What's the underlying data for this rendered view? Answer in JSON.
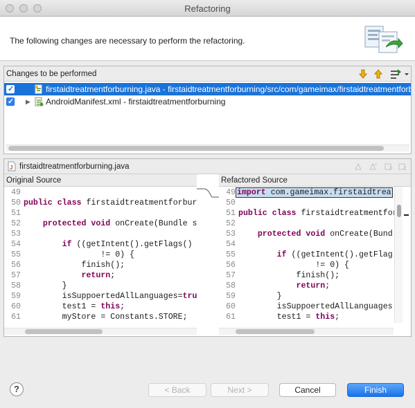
{
  "window": {
    "title": "Refactoring"
  },
  "header": {
    "message": "The following changes are necessary to perform the refactoring."
  },
  "changes": {
    "title": "Changes to be performed",
    "items": [
      {
        "label": "firstaidtreatmentforburning.java - firstaidtreatmentforburning/src/com/gameimax/firstaidtreatmentforburning",
        "checked": true,
        "selected": true
      },
      {
        "label": "AndroidManifest.xml - firstaidtreatmentforburning",
        "checked": true,
        "selected": false
      }
    ]
  },
  "compare": {
    "file": "firstaidtreatmentforburning.java",
    "original_label": "Original Source",
    "refactored_label": "Refactored Source",
    "original_lines": [
      {
        "n": "49",
        "t": ""
      },
      {
        "n": "50",
        "t": "public class firstaidtreatmentforburni"
      },
      {
        "n": "51",
        "t": ""
      },
      {
        "n": "52",
        "t": "    protected void onCreate(Bundle s"
      },
      {
        "n": "53",
        "t": ""
      },
      {
        "n": "54",
        "t": "        if ((getIntent().getFlags()"
      },
      {
        "n": "55",
        "t": "                != 0) {"
      },
      {
        "n": "56",
        "t": "            finish();"
      },
      {
        "n": "57",
        "t": "            return;"
      },
      {
        "n": "58",
        "t": "        }"
      },
      {
        "n": "59",
        "t": "        isSuppoertedAllLanguages=tru"
      },
      {
        "n": "60",
        "t": "        test1 = this;"
      },
      {
        "n": "61",
        "t": "        myStore = Constants.STORE;"
      }
    ],
    "refactored_lines": [
      {
        "n": "49",
        "t": "import com.gameimax.firstaidtrea"
      },
      {
        "n": "50",
        "t": ""
      },
      {
        "n": "51",
        "t": "public class firstaidtreatmentforbu"
      },
      {
        "n": "52",
        "t": ""
      },
      {
        "n": "53",
        "t": "    protected void onCreate(Bund"
      },
      {
        "n": "54",
        "t": ""
      },
      {
        "n": "55",
        "t": "        if ((getIntent().getFlag"
      },
      {
        "n": "56",
        "t": "                != 0) {"
      },
      {
        "n": "57",
        "t": "            finish();"
      },
      {
        "n": "58",
        "t": "            return;"
      },
      {
        "n": "59",
        "t": "        }"
      },
      {
        "n": "60",
        "t": "        isSuppoertedAllLanguages"
      },
      {
        "n": "61",
        "t": "        test1 = this;"
      }
    ]
  },
  "buttons": {
    "help": "?",
    "back": "< Back",
    "next": "Next >",
    "cancel": "Cancel",
    "finish": "Finish"
  },
  "colors": {
    "selection": "#1a73d9",
    "keyword": "#7f0055",
    "primary_button": "#1a73e8"
  }
}
